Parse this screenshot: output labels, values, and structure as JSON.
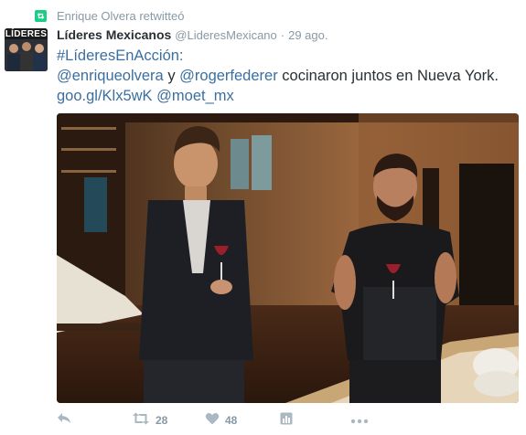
{
  "retweet_context": {
    "text": "Enrique Olvera retwitteó"
  },
  "avatar": {
    "label": "LÍDERES"
  },
  "tweet": {
    "fullname": "Líderes Mexicanos",
    "username": "@LideresMexicano",
    "separator": "·",
    "time": "29 ago.",
    "hashtag": "#LíderesEnAcción:",
    "mention1": "@enriqueolvera",
    "y": " y ",
    "mention2": "@rogerfederer",
    "body": " cocinaron juntos en Nueva York.",
    "link": "goo.gl/Klx5wK",
    "mention3": "@moet_mx"
  },
  "actions": {
    "retweet_count": "28",
    "like_count": "48"
  },
  "icons": [
    "retweet-badge-icon",
    "reply-icon",
    "retweet-icon",
    "like-icon",
    "analytics-icon",
    "more-icon"
  ],
  "colors": {
    "link": "#3b6fa0",
    "muted": "#8899a6",
    "retweet_green": "#19cf86"
  }
}
